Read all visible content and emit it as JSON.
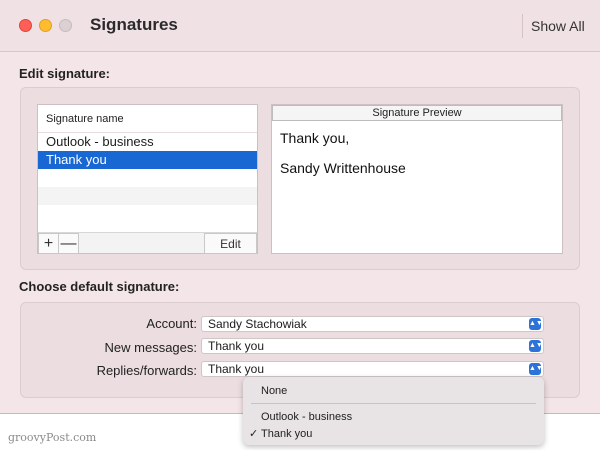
{
  "window": {
    "title": "Signatures",
    "show_all_label": "Show All"
  },
  "edit_signature": {
    "heading": "Edit signature:",
    "list_header": "Signature name",
    "items": [
      "Outlook - business",
      "Thank you"
    ],
    "selected_index": 1,
    "add_label": "+",
    "remove_label": "—",
    "edit_label": "Edit",
    "preview_header": "Signature Preview",
    "preview_lines": [
      "Thank you,",
      "Sandy Writtenhouse"
    ]
  },
  "default_signature": {
    "heading": "Choose default signature:",
    "account_label": "Account:",
    "account_value": "Sandy Stachowiak",
    "new_messages_label": "New messages:",
    "new_messages_value": "Thank you",
    "replies_label": "Replies/forwards:",
    "replies_value": "Thank you"
  },
  "dropdown": {
    "options": [
      "None",
      "Outlook - business",
      "Thank you"
    ],
    "checked_index": 2,
    "check_glyph": "✓"
  },
  "watermark": "groovyPost.com",
  "colors": {
    "selection": "#1867d3",
    "window_bg": "#f4e5e8",
    "select_arrow": "#2c72d8"
  }
}
